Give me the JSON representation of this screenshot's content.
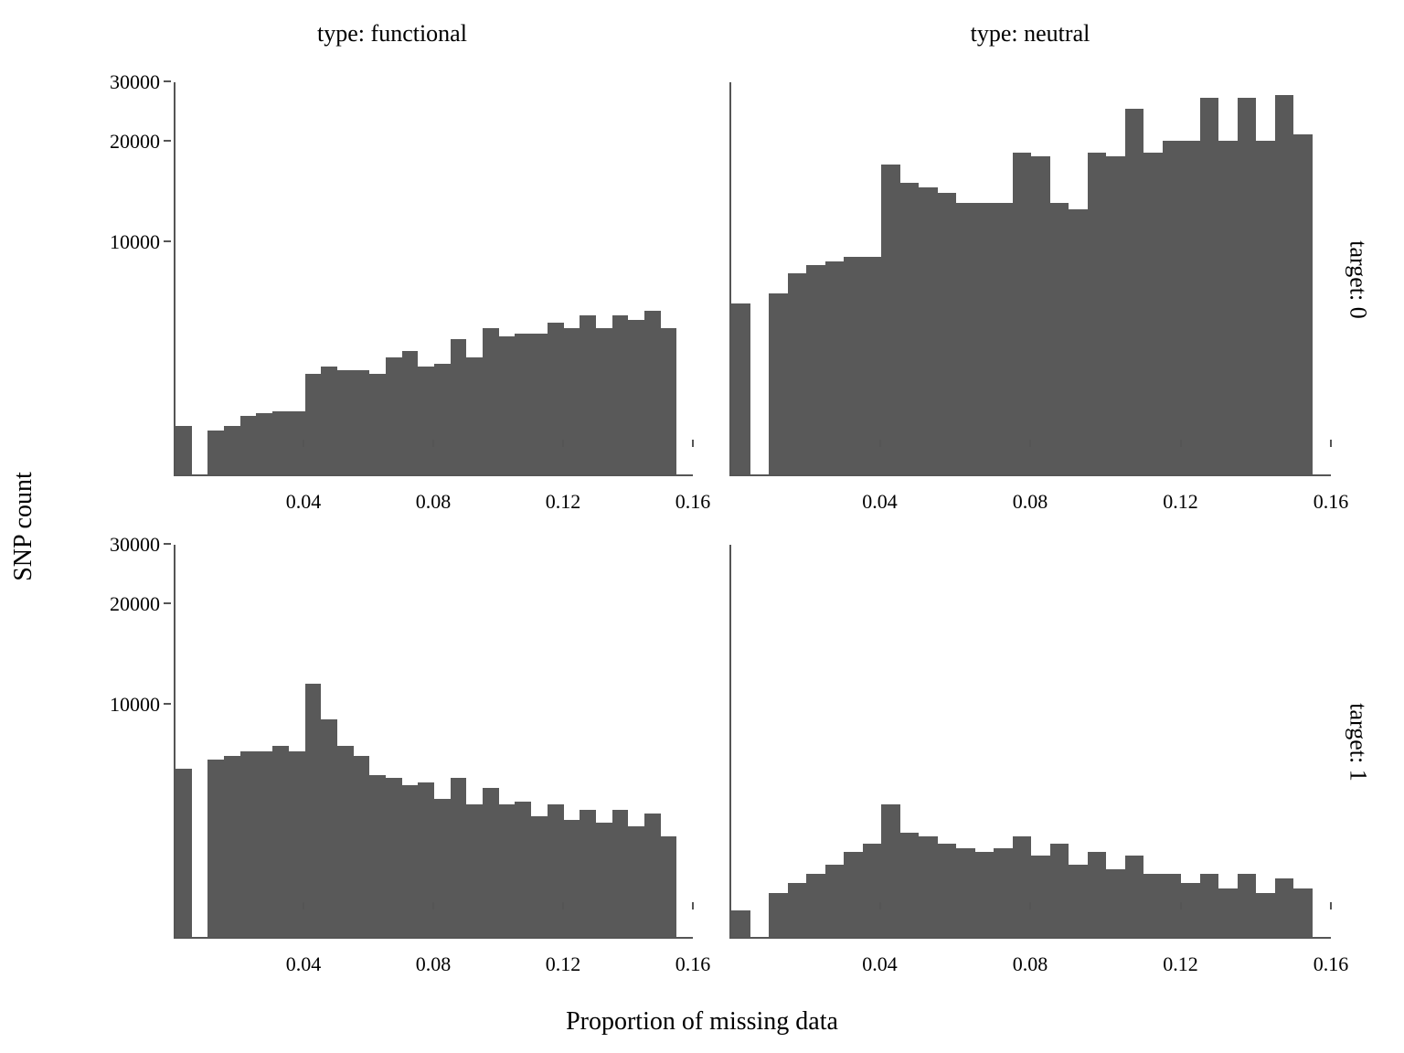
{
  "axes": {
    "xlabel": "Proportion of missing data",
    "ylabel": "SNP count",
    "col_headers": [
      "type: functional",
      "type: neutral"
    ],
    "row_strips": [
      "target: 0",
      "target: 1"
    ]
  },
  "chart_data": [
    {
      "type": "bar",
      "facet_row": "target: 0",
      "facet_col": "type: functional",
      "xlabel": "Proportion of missing data",
      "ylabel": "SNP count",
      "title": "",
      "y_log": true,
      "ylim": [
        2000,
        30000
      ],
      "xlim": [
        0,
        0.16
      ],
      "x_ticks": [
        0.04,
        0.08,
        0.12,
        0.16
      ],
      "y_ticks": [
        10000,
        20000,
        30000
      ],
      "bin_edges": [
        0.0,
        0.005,
        0.01,
        0.015,
        0.02,
        0.025,
        0.03,
        0.035,
        0.04,
        0.045,
        0.05,
        0.055,
        0.06,
        0.065,
        0.07,
        0.075,
        0.08,
        0.085,
        0.09,
        0.095,
        0.1,
        0.105,
        0.11,
        0.115,
        0.12,
        0.125,
        0.13,
        0.135,
        0.14,
        0.145,
        0.15,
        0.155,
        0.16
      ],
      "values": [
        2800,
        0,
        2700,
        2800,
        3000,
        3050,
        3100,
        3100,
        4000,
        4200,
        4100,
        4100,
        4000,
        4500,
        4700,
        4200,
        4300,
        5100,
        4500,
        5500,
        5200,
        5300,
        5300,
        5700,
        5500,
        6000,
        5500,
        6000,
        5800,
        6200,
        5500,
        0
      ]
    },
    {
      "type": "bar",
      "facet_row": "target: 0",
      "facet_col": "type: neutral",
      "xlabel": "Proportion of missing data",
      "ylabel": "SNP count",
      "title": "",
      "y_log": true,
      "ylim": [
        2000,
        30000
      ],
      "xlim": [
        0,
        0.16
      ],
      "x_ticks": [
        0.04,
        0.08,
        0.12,
        0.16
      ],
      "y_ticks": [
        10000,
        20000,
        30000
      ],
      "bin_edges": [
        0.0,
        0.005,
        0.01,
        0.015,
        0.02,
        0.025,
        0.03,
        0.035,
        0.04,
        0.045,
        0.05,
        0.055,
        0.06,
        0.065,
        0.07,
        0.075,
        0.08,
        0.085,
        0.09,
        0.095,
        0.1,
        0.105,
        0.11,
        0.115,
        0.12,
        0.125,
        0.13,
        0.135,
        0.14,
        0.145,
        0.15,
        0.155,
        0.16
      ],
      "values": [
        6500,
        0,
        7000,
        8000,
        8500,
        8700,
        9000,
        9000,
        17000,
        15000,
        14500,
        14000,
        13000,
        13000,
        13000,
        18500,
        18000,
        13000,
        12500,
        18500,
        18000,
        25000,
        18500,
        20000,
        20000,
        27000,
        20000,
        27000,
        20000,
        27500,
        21000,
        0
      ]
    },
    {
      "type": "bar",
      "facet_row": "target: 1",
      "facet_col": "type: functional",
      "xlabel": "Proportion of missing data",
      "ylabel": "SNP count",
      "title": "",
      "y_log": true,
      "ylim": [
        2000,
        30000
      ],
      "xlim": [
        0,
        0.16
      ],
      "x_ticks": [
        0.04,
        0.08,
        0.12,
        0.16
      ],
      "y_ticks": [
        10000,
        20000,
        30000
      ],
      "bin_edges": [
        0.0,
        0.005,
        0.01,
        0.015,
        0.02,
        0.025,
        0.03,
        0.035,
        0.04,
        0.045,
        0.05,
        0.055,
        0.06,
        0.065,
        0.07,
        0.075,
        0.08,
        0.085,
        0.09,
        0.095,
        0.1,
        0.105,
        0.11,
        0.115,
        0.12,
        0.125,
        0.13,
        0.135,
        0.14,
        0.145,
        0.15,
        0.155,
        0.16
      ],
      "values": [
        6400,
        0,
        6800,
        7000,
        7200,
        7200,
        7500,
        7200,
        11500,
        9000,
        7500,
        7000,
        6100,
        6000,
        5700,
        5800,
        5200,
        6000,
        5000,
        5600,
        5000,
        5100,
        4600,
        5000,
        4500,
        4800,
        4400,
        4800,
        4300,
        4700,
        4000,
        0
      ]
    },
    {
      "type": "bar",
      "facet_row": "target: 1",
      "facet_col": "type: neutral",
      "xlabel": "Proportion of missing data",
      "ylabel": "SNP count",
      "title": "",
      "y_log": true,
      "ylim": [
        2000,
        30000
      ],
      "xlim": [
        0,
        0.16
      ],
      "x_ticks": [
        0.04,
        0.08,
        0.12,
        0.16
      ],
      "y_ticks": [
        10000,
        20000,
        30000
      ],
      "bin_edges": [
        0.0,
        0.005,
        0.01,
        0.015,
        0.02,
        0.025,
        0.03,
        0.035,
        0.04,
        0.045,
        0.05,
        0.055,
        0.06,
        0.065,
        0.07,
        0.075,
        0.08,
        0.085,
        0.09,
        0.095,
        0.1,
        0.105,
        0.11,
        0.115,
        0.12,
        0.125,
        0.13,
        0.135,
        0.14,
        0.145,
        0.15,
        0.155,
        0.16
      ],
      "values": [
        2400,
        0,
        2700,
        2900,
        3100,
        3300,
        3600,
        3800,
        5000,
        4100,
        4000,
        3800,
        3700,
        3600,
        3700,
        4000,
        3500,
        3800,
        3300,
        3600,
        3200,
        3500,
        3100,
        3100,
        2900,
        3100,
        2800,
        3100,
        2700,
        3000,
        2800,
        0
      ]
    }
  ]
}
